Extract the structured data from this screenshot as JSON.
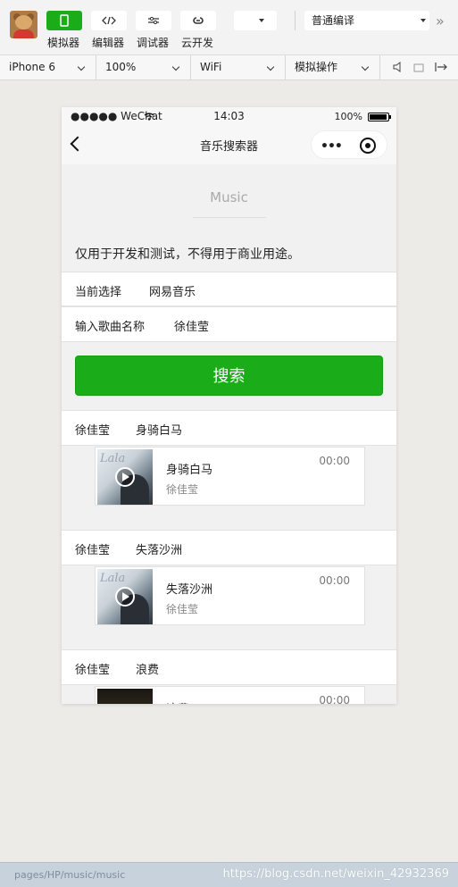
{
  "toolbar": {
    "buttons": [
      {
        "label": "模拟器",
        "active": true
      },
      {
        "label": "编辑器",
        "active": false
      },
      {
        "label": "调试器",
        "active": false
      },
      {
        "label": "云开发",
        "active": false
      }
    ],
    "mode_value": "",
    "compile_mode": "普通编译",
    "more": "»"
  },
  "device_bar": {
    "device": "iPhone 6",
    "zoom": "100%",
    "network": "WiFi",
    "operation": "模拟操作"
  },
  "status_bar": {
    "carrier": "●●●●● WeChat",
    "time": "14:03",
    "battery": "100%"
  },
  "nav": {
    "title": "音乐搜索器",
    "menu_dots": "•••"
  },
  "page": {
    "header": "Music",
    "notice": "仅用于开发和测试，不得用于商业用途。",
    "source_label": "当前选择",
    "source_value": "网易音乐",
    "song_label": "输入歌曲名称",
    "song_value": "徐佳莹",
    "search_button": "搜索"
  },
  "results": [
    {
      "artist": "徐佳莹",
      "title": "身骑白马",
      "duration": "00:00",
      "cover": "album-cover-lala"
    },
    {
      "artist": "徐佳莹",
      "title": "失落沙洲",
      "duration": "00:00",
      "cover": "album-cover-lala"
    },
    {
      "artist": "徐佳莹",
      "title": "浪费",
      "duration": "00:00",
      "cover": "album-cover-dark"
    }
  ],
  "bottom": {
    "path": "pages/HP/music/music",
    "watermark": "https://blog.csdn.net/weixin_42932369"
  },
  "colors": {
    "accent": "#1aad19",
    "background": "#ecebe8"
  }
}
